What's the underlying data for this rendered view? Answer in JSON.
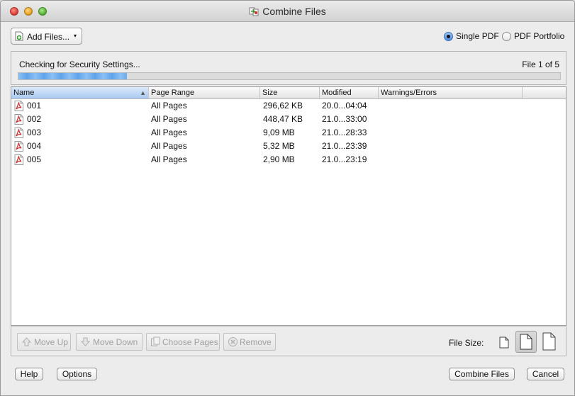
{
  "window": {
    "title": "Combine Files"
  },
  "toolbar": {
    "add_files_label": "Add Files...",
    "add_files_caret": "▾",
    "output_options": [
      {
        "label": "Single PDF",
        "selected": true
      },
      {
        "label": "PDF Portfolio",
        "selected": false
      }
    ]
  },
  "status": {
    "message": "Checking for Security Settings...",
    "file_counter": "File 1 of 5",
    "progress": 0.2
  },
  "table": {
    "columns": [
      "Name",
      "Page Range",
      "Size",
      "Modified",
      "Warnings/Errors"
    ],
    "sort_column": "Name",
    "sort_direction": "ascending",
    "rows": [
      {
        "name": "001",
        "page_range": "All Pages",
        "size": "296,62 KB",
        "modified": "20.0...04:04",
        "warnings": ""
      },
      {
        "name": "002",
        "page_range": "All Pages",
        "size": "448,47 KB",
        "modified": "21.0...33:00",
        "warnings": ""
      },
      {
        "name": "003",
        "page_range": "All Pages",
        "size": "9,09 MB",
        "modified": "21.0...28:33",
        "warnings": ""
      },
      {
        "name": "004",
        "page_range": "All Pages",
        "size": "5,32 MB",
        "modified": "21.0...23:39",
        "warnings": ""
      },
      {
        "name": "005",
        "page_range": "All Pages",
        "size": "2,90 MB",
        "modified": "21.0...23:19",
        "warnings": ""
      }
    ]
  },
  "actions": {
    "move_up": "Move Up",
    "move_down": "Move Down",
    "choose_pages": "Choose Pages",
    "remove": "Remove",
    "file_size_label": "File Size:",
    "file_size_options": [
      "small-file-size-icon",
      "default-file-size-icon",
      "large-file-size-icon"
    ],
    "file_size_selected": 1
  },
  "footer": {
    "help": "Help",
    "options": "Options",
    "combine": "Combine Files",
    "cancel": "Cancel"
  },
  "colors": {
    "progress": "#5ea4ec",
    "pdf_icon": "#d12c2c",
    "sorted_header": "#a9c9f1"
  }
}
